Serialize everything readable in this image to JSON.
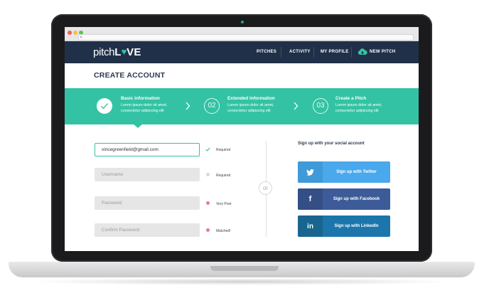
{
  "brand": {
    "logo_part1": "pitch",
    "logo_part2": "L",
    "logo_heart": "♥",
    "logo_part3": "VE"
  },
  "nav": {
    "items": [
      {
        "label": "PITCHES"
      },
      {
        "label": "ACTIVITY"
      },
      {
        "label": "MY PROFILE"
      }
    ],
    "new_pitch": "NEW PITCH",
    "new_pitch_icon": "cloud-upload-icon"
  },
  "page": {
    "title": "CREATE ACCOUNT"
  },
  "steps": [
    {
      "title": "Basic Information",
      "desc1": "Lorem ipsum dolor sit amet,",
      "desc2": "consectetur adipiscing elit",
      "state": "done",
      "icon": "check-icon"
    },
    {
      "number": "02",
      "title": "Extended Information",
      "desc1": "Lorem ipsum dolor sit amet,",
      "desc2": "consectetur adipiscing elit",
      "state": "pending"
    },
    {
      "number": "03",
      "title": "Create a Pitch",
      "desc1": "Lorem ipsum dolor sit amet,",
      "desc2": "consectetur adipiscing elit",
      "state": "pending"
    }
  ],
  "form": {
    "email": {
      "value": "vincegreenfield@gmail.com",
      "status": "Required",
      "status_icon": "check-icon"
    },
    "username": {
      "placeholder": "Username",
      "status": "Required",
      "status_color": "#d8d8da"
    },
    "password": {
      "placeholder": "Password",
      "status": "Very Poor",
      "status_color": "#e8789a"
    },
    "confirm": {
      "placeholder": "Confirm Password",
      "status": "Matched!",
      "status_color": "#e8789a"
    }
  },
  "divider_label": "or",
  "social": {
    "title": "Sign up with your social account",
    "buttons": [
      {
        "label": "Sign up with Twitter",
        "icon": "twitter-icon",
        "color": "#4aa8ec",
        "icon_bg": "#3e9ad9"
      },
      {
        "label": "Sign up with Facebook",
        "icon": "facebook-icon",
        "color": "#3d5b98",
        "icon_bg": "#344f86"
      },
      {
        "label": "Sign up with LinkedIn",
        "icon": "linkedin-icon",
        "color": "#1d76ab",
        "icon_bg": "#18668f"
      }
    ]
  },
  "colors": {
    "nav": "#203048",
    "accent": "#33c3a4",
    "title": "#2a3a52"
  }
}
